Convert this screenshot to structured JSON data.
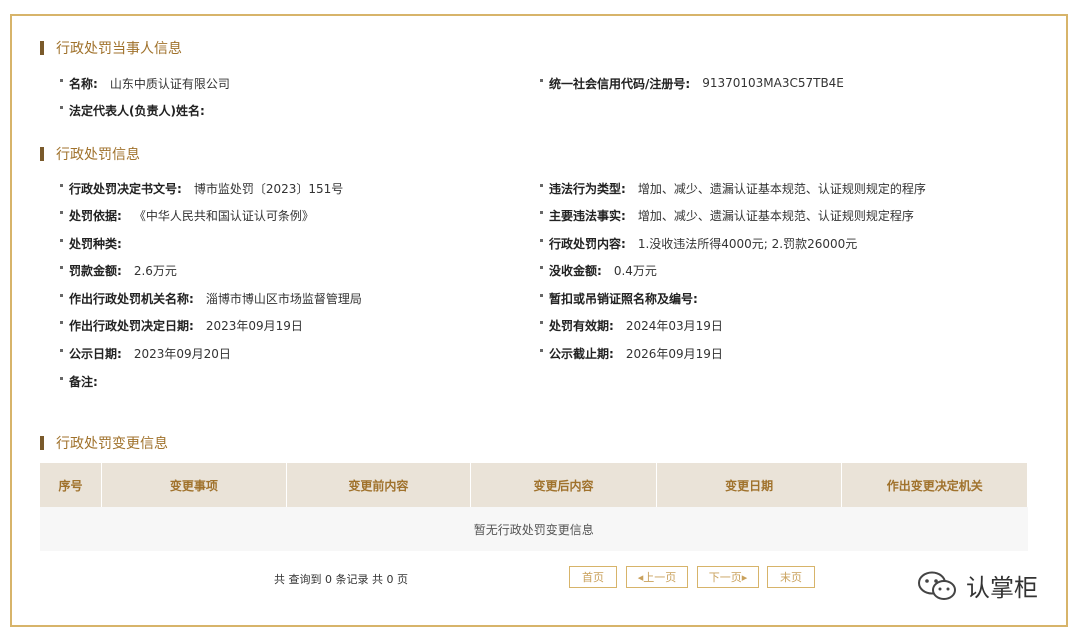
{
  "party": {
    "title": "行政处罚当事人信息",
    "name_label": "名称:",
    "name_value": "山东中质认证有限公司",
    "credit_label": "统一社会信用代码/注册号:",
    "credit_value": "91370103MA3C57TB4E",
    "legal_label": "法定代表人(负责人)姓名:",
    "legal_value": ""
  },
  "penalty": {
    "title": "行政处罚信息",
    "left": [
      {
        "label": "行政处罚决定书文号:",
        "value": "博市监处罚〔2023〕151号"
      },
      {
        "label": "处罚依据:",
        "value": "《中华人民共和国认证认可条例》"
      },
      {
        "label": "处罚种类:",
        "value": ""
      },
      {
        "label": "罚款金额:",
        "value": "2.6万元"
      },
      {
        "label": "作出行政处罚机关名称:",
        "value": "淄博市博山区市场监督管理局"
      },
      {
        "label": "作出行政处罚决定日期:",
        "value": "2023年09月19日"
      },
      {
        "label": "公示日期:",
        "value": "2023年09月20日"
      },
      {
        "label": "备注:",
        "value": ""
      }
    ],
    "right": [
      {
        "label": "违法行为类型:",
        "value": "增加、减少、遗漏认证基本规范、认证规则规定的程序"
      },
      {
        "label": "主要违法事实:",
        "value": "增加、减少、遗漏认证基本规范、认证规则规定程序"
      },
      {
        "label": "行政处罚内容:",
        "value": "1.没收违法所得4000元; 2.罚款26000元"
      },
      {
        "label": "没收金额:",
        "value": "0.4万元"
      },
      {
        "label": "暂扣或吊销证照名称及编号:",
        "value": ""
      },
      {
        "label": "处罚有效期:",
        "value": "2024年03月19日"
      },
      {
        "label": "公示截止期:",
        "value": "2026年09月19日"
      }
    ]
  },
  "changes": {
    "title": "行政处罚变更信息",
    "headers": [
      "序号",
      "变更事项",
      "变更前内容",
      "变更后内容",
      "变更日期",
      "作出变更决定机关"
    ],
    "empty_text": "暂无行政处罚变更信息"
  },
  "pager": {
    "info": "共 查询到 0 条记录 共 0 页",
    "first": "首页",
    "prev": "◂上一页",
    "next": "下一页▸",
    "last": "末页"
  },
  "watermark": {
    "text": "认掌柜",
    "icon": "wechat-icon"
  },
  "colors": {
    "border": "#d7b46a",
    "accent": "#a0722c",
    "header_bg": "#eae3d8"
  }
}
